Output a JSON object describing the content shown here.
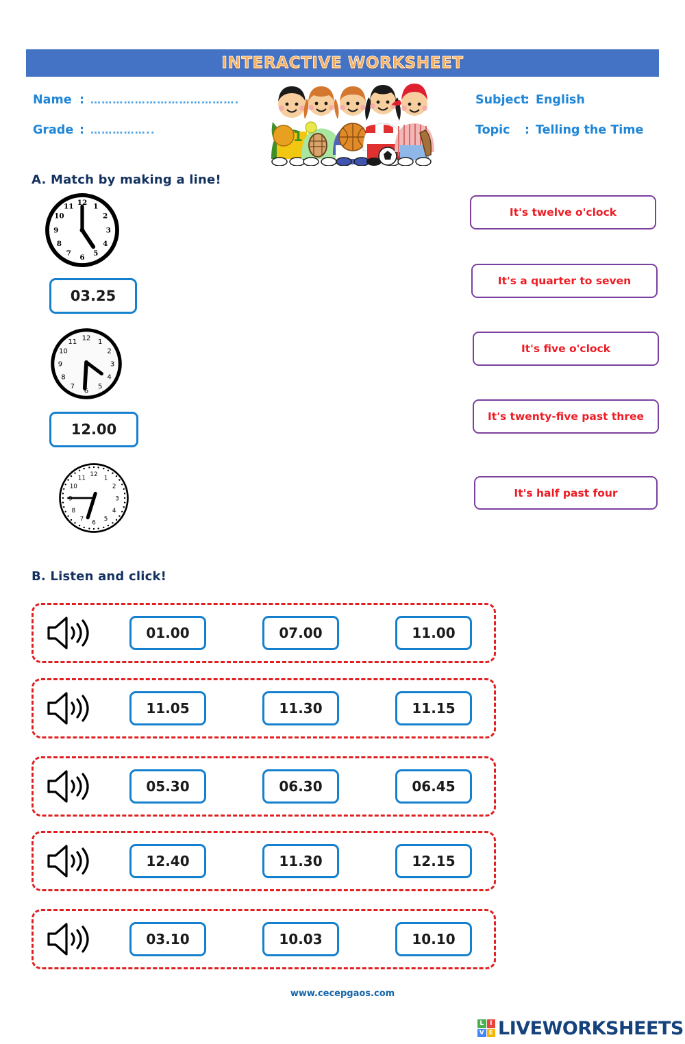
{
  "header": {
    "title": "INTERACTIVE WORKSHEET",
    "bar_color": "#4472c4",
    "title_color": "#f6ad5b"
  },
  "meta": {
    "name_label": "Name",
    "name_colon": ":",
    "name_value": "………………………………….",
    "grade_label": "Grade",
    "grade_colon": ":",
    "grade_value": "……………..",
    "subject_label": "Subject",
    "subject_colon": ":",
    "subject_value": "English",
    "topic_label": "Topic",
    "topic_colon": ":",
    "topic_value": "Telling the Time",
    "text_color": "#1f86d8"
  },
  "illustration": {
    "name": "five-kids-with-sports-equipment"
  },
  "section_a": {
    "heading": "A.  Match by making a line!",
    "clocks": [
      {
        "name": "clock-five-oclock",
        "hour": 5,
        "minute": 0,
        "style": "bold-roman"
      },
      {
        "name": "clock-half-past-four",
        "hour": 4,
        "minute": 30,
        "style": "plain"
      },
      {
        "name": "clock-quarter-to-seven",
        "hour": 6,
        "minute": 45,
        "style": "dotted"
      }
    ],
    "time_boxes": [
      {
        "value": "03.25"
      },
      {
        "value": "12.00"
      }
    ],
    "phrases": [
      {
        "text": "It's twelve o'clock"
      },
      {
        "text": "It's a quarter to seven"
      },
      {
        "text": "It's five o'clock"
      },
      {
        "text": "It's twenty-five past three"
      },
      {
        "text": "It's half past four"
      }
    ],
    "box_border_color": "#1580ce",
    "phrase_border_color": "#7b3fa0",
    "phrase_text_color": "#ed1c24"
  },
  "section_b": {
    "heading": "B. Listen and click!",
    "row_border_color": "#e02020",
    "rows": [
      {
        "icon": "speaker-icon",
        "options": [
          "01.00",
          "07.00",
          "11.00"
        ]
      },
      {
        "icon": "speaker-icon",
        "options": [
          "11.05",
          "11.30",
          "11.15"
        ]
      },
      {
        "icon": "speaker-icon",
        "options": [
          "05.30",
          "06.30",
          "06.45"
        ]
      },
      {
        "icon": "speaker-icon",
        "options": [
          "12.40",
          "11.30",
          "12.15"
        ]
      },
      {
        "icon": "speaker-icon",
        "options": [
          "03.10",
          "10.03",
          "10.10"
        ]
      }
    ]
  },
  "footer": {
    "site_url": "www.cecepgaos.com",
    "logo_cells": [
      {
        "letter": "L",
        "color": "#4caf50"
      },
      {
        "letter": "I",
        "color": "#e8453c"
      },
      {
        "letter": "V",
        "color": "#4285f4"
      },
      {
        "letter": "E",
        "color": "#f4b400"
      }
    ],
    "logo_word": "LIVEWORKSHEETS",
    "logo_word_color": "#16427c"
  }
}
